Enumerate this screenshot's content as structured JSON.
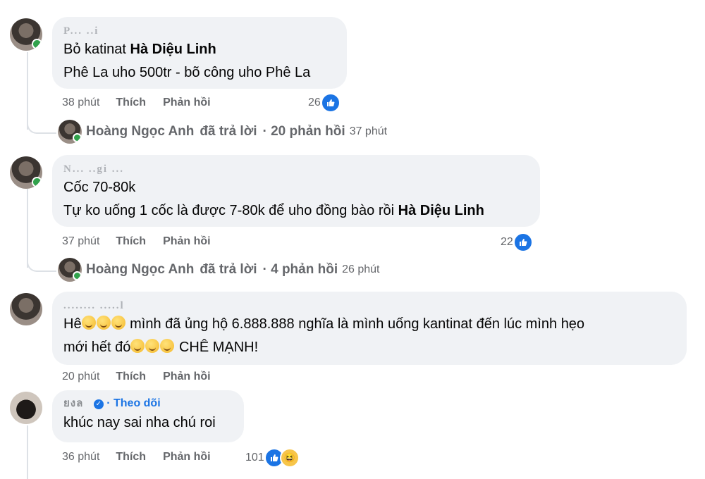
{
  "comments": [
    {
      "author": "P... ..i",
      "line1_pre": "Bỏ katinat ",
      "line1_tag": "Hà Diệu Linh",
      "line2": "Phê La uho 500tr - bõ công uho Phê La",
      "time": "38 phút",
      "like": "Thích",
      "reply": "Phản hồi",
      "reactions": "26",
      "replies": {
        "name": "Hoàng Ngọc Anh",
        "action": "đã trả lời",
        "count": "· 20 phản hồi",
        "time": "37 phút"
      }
    },
    {
      "author": "N... ..gi ...",
      "line1": "Cốc 70-80k",
      "line2_pre": "Tự ko uống 1 cốc là được 7-80k để uho đồng bào rồi ",
      "line2_tag": "Hà Diệu Linh",
      "time": "37 phút",
      "like": "Thích",
      "reply": "Phản hồi",
      "reactions": "22",
      "replies": {
        "name": "Hoàng Ngọc Anh",
        "action": "đã trả lời",
        "count": "· 4 phản hồi",
        "time": "26 phút"
      }
    },
    {
      "author": "........ .....l",
      "line1_a": "Hê",
      "line1_b": " mình đã ủng hộ 6.888.888 nghĩa là mình uống kantinat đến lúc mình hẹo",
      "line2_a": "mới hết đó",
      "line2_b": " CHÊ MẠNH!",
      "time": "20 phút",
      "like": "Thích",
      "reply": "Phản hồi"
    },
    {
      "author": "ยงล",
      "follow": "· Theo dõi",
      "line1": "khúc nay sai nha chú roi",
      "time": "36 phút",
      "like": "Thích",
      "reply": "Phản hồi",
      "reactions": "101"
    }
  ],
  "icons": [
    "like-icon",
    "haha-icon",
    "verified-icon",
    "grinning-emoji"
  ],
  "colors": {
    "bubble": "#f0f2f5",
    "like": "#1b74e4",
    "online": "#31a24c",
    "meta": "#65676b"
  }
}
